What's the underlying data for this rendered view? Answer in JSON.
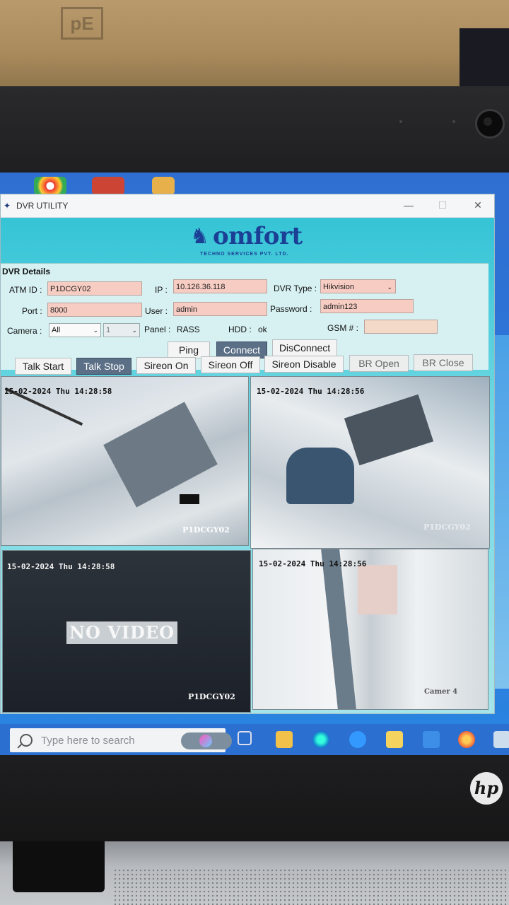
{
  "window": {
    "title": "DVR UTILITY",
    "minimize": "—",
    "maximize": "☐",
    "close": "✕"
  },
  "logo": {
    "word": "omfort",
    "subtitle": "TECHNO SERVICES PVT. LTD."
  },
  "details": {
    "group_label": "DVR Details",
    "atm_id_label": "ATM ID :",
    "atm_id_value": "P1DCGY02",
    "ip_label": "IP :",
    "ip_value": "10.126.36.118",
    "dvr_type_label": "DVR Type :",
    "dvr_type_value": "Hikvision",
    "port_label": "Port :",
    "port_value": "8000",
    "user_label": "User :",
    "user_value": "admin",
    "password_label": "Password :",
    "password_value": "admin123",
    "camera_label": "Camera :",
    "camera_value": "All",
    "camera_num_value": "1",
    "panel_label": "Panel :",
    "panel_value": "RASS",
    "hdd_label": "HDD :",
    "hdd_value": "ok",
    "gsm_label": "GSM # :",
    "gsm_value": ""
  },
  "buttons": {
    "ping": "Ping",
    "connect": "Connect",
    "disconnect": "DisConnect",
    "talk_start": "Talk Start",
    "talk_stop": "Talk Stop",
    "sireon_on": "Sireon On",
    "sireon_off": "Sireon Off",
    "sireon_disable": "Sireon Disable",
    "br_open": "BR Open",
    "br_close": "BR Close"
  },
  "cameras": [
    {
      "timestamp": "15-02-2024 Thu 14:28:58",
      "name": "P1DCGY02"
    },
    {
      "timestamp": "15-02-2024 Thu 14:28:56",
      "name": "P1DCGY02"
    },
    {
      "timestamp": "15-02-2024 Thu 14:28:58",
      "name": "P1DCGY02",
      "status": "NO VIDEO"
    },
    {
      "timestamp": "15-02-2024 Thu 14:28:56",
      "name": "Camer 4"
    }
  ],
  "taskbar": {
    "search_placeholder": "Type here to search"
  },
  "colors": {
    "field_bg": "#f7ccc2",
    "active_button": "#5b6f86",
    "app_bg": "#35c4d6",
    "brand": "#1b3f95"
  }
}
